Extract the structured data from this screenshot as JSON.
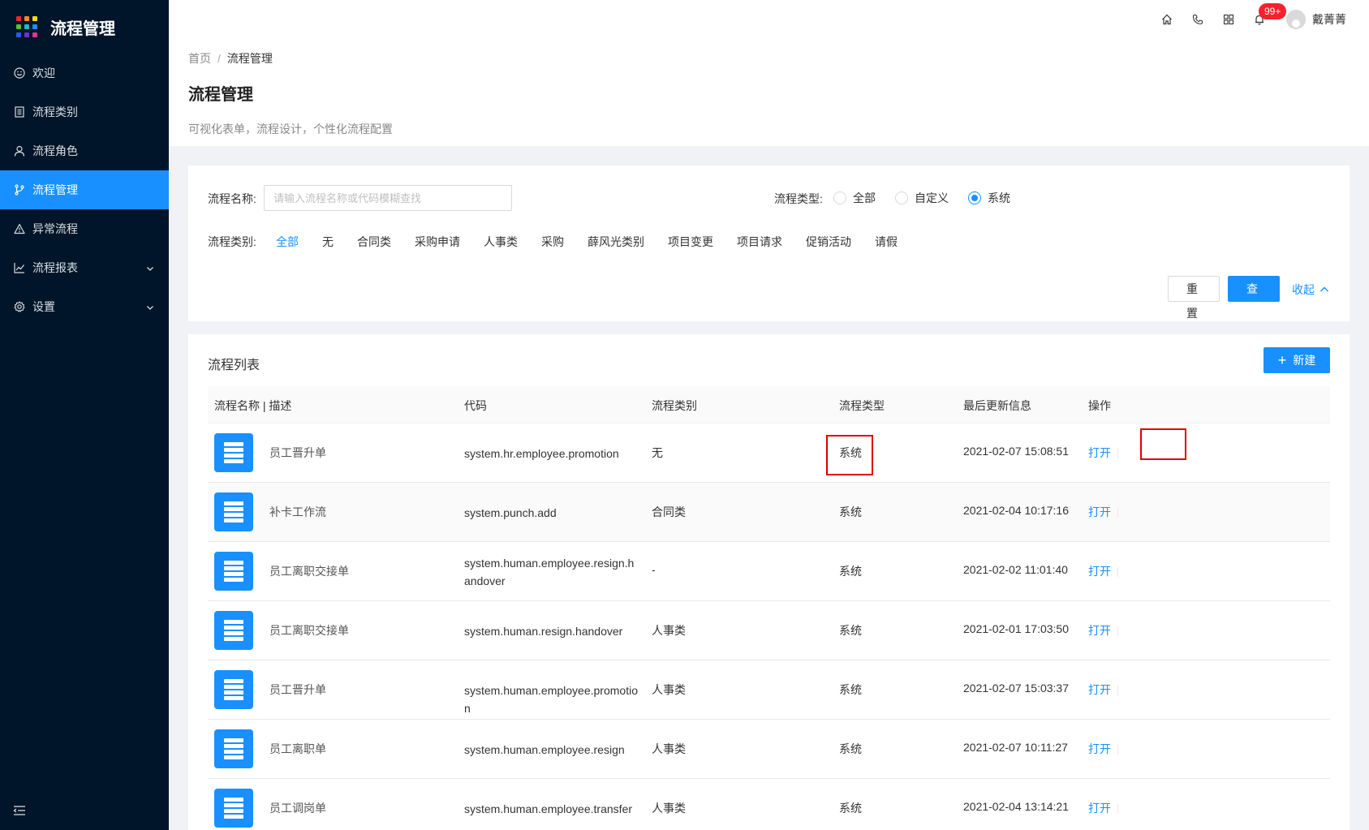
{
  "app": {
    "title": "流程管理",
    "logo_colors": [
      "#f5222d",
      "#fa8c16",
      "#fadb14",
      "#52c41a",
      "#13c2c2",
      "#1890ff",
      "#2f54eb",
      "#722ed1",
      "#eb2f96"
    ]
  },
  "sidebar": {
    "items": [
      {
        "label": "欢迎",
        "icon": "smile-icon"
      },
      {
        "label": "流程类别",
        "icon": "list-icon"
      },
      {
        "label": "流程角色",
        "icon": "user-icon"
      },
      {
        "label": "流程管理",
        "icon": "branch-icon"
      },
      {
        "label": "异常流程",
        "icon": "warning-icon"
      },
      {
        "label": "流程报表",
        "icon": "chart-icon"
      },
      {
        "label": "设置",
        "icon": "gear-icon"
      }
    ],
    "active_index": 3
  },
  "header": {
    "notification_count": "99+",
    "username": "戴菁菁"
  },
  "page": {
    "breadcrumb_home": "首页",
    "breadcrumb_sep": "/",
    "breadcrumb_current": "流程管理",
    "title": "流程管理",
    "description": "可视化表单，流程设计，个性化流程配置"
  },
  "filter": {
    "name_label": "流程名称:",
    "name_placeholder": "请输入流程名称或代码模糊查找",
    "type_label": "流程类型:",
    "type_options": [
      "全部",
      "自定义",
      "系统"
    ],
    "type_selected": 2,
    "category_label": "流程类别:",
    "categories": [
      "全部",
      "无",
      "合同类",
      "采购申请",
      "人事类",
      "采购",
      "薛风光类别",
      "项目变更",
      "项目请求",
      "促销活动",
      "请假"
    ],
    "category_selected": 0,
    "reset_label": "重置",
    "query_label": "查询",
    "collapse_label": "收起"
  },
  "list": {
    "title": "流程列表",
    "new_label": "新建",
    "columns": [
      "流程名称 | 描述",
      "代码",
      "流程类别",
      "流程类型",
      "最后更新信息",
      "操作"
    ],
    "rows": [
      {
        "name": "员工晋升单",
        "code": "system.hr.employee.promotion",
        "category": "无",
        "type": "系统",
        "updated": "2021-02-07 15:08:51",
        "action": "打开"
      },
      {
        "name": "补卡工作流",
        "code": "system.punch.add",
        "category": "合同类",
        "type": "系统",
        "updated": "2021-02-04 10:17:16",
        "action": "打开"
      },
      {
        "name": "员工离职交接单",
        "code": "system.human.employee.resign.handover",
        "category": "-",
        "type": "系统",
        "updated": "2021-02-02 11:01:40",
        "action": "打开"
      },
      {
        "name": "员工离职交接单",
        "code": "system.human.resign.handover",
        "category": "人事类",
        "type": "系统",
        "updated": "2021-02-01 17:03:50",
        "action": "打开"
      },
      {
        "name": "员工晋升单",
        "code": "system.human.employee.promotion",
        "category": "人事类",
        "type": "系统",
        "updated": "2021-02-07 15:03:37",
        "action": "打开"
      },
      {
        "name": "员工离职单",
        "code": "system.human.employee.resign",
        "category": "人事类",
        "type": "系统",
        "updated": "2021-02-07 10:11:27",
        "action": "打开"
      },
      {
        "name": "员工调岗单",
        "code": "system.human.employee.transfer",
        "category": "人事类",
        "type": "系统",
        "updated": "2021-02-04 13:14:21",
        "action": "打开"
      }
    ]
  },
  "colors": {
    "sidebar_bg": "#001529",
    "primary": "#1890ff",
    "highlight_box": "#e00000"
  }
}
